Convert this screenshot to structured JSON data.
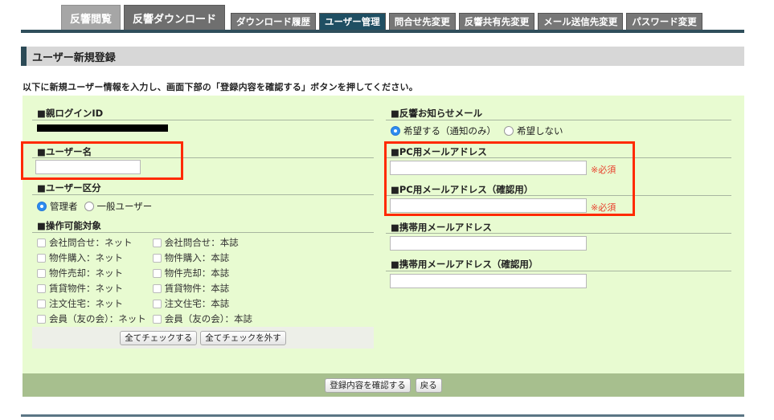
{
  "tabs_main": [
    {
      "label": "反響閲覧",
      "active": false
    },
    {
      "label": "反響ダウンロード",
      "active": true
    }
  ],
  "tabs_sub": [
    {
      "label": "ダウンロード履歴",
      "active": false
    },
    {
      "label": "ユーザー管理",
      "active": true
    },
    {
      "label": "問合せ先変更",
      "active": false
    },
    {
      "label": "反響共有先変更",
      "active": false
    },
    {
      "label": "メール送信先変更",
      "active": false
    },
    {
      "label": "パスワード変更",
      "active": false
    }
  ],
  "section_title": "ユーザー新規登録",
  "instruction": "以下に新規ユーザー情報を入力し、画面下部の「登録内容を確認する」ボタンを押してください。",
  "left": {
    "parent_login_id_label": "■親ログインID",
    "user_name_label": "■ユーザー名",
    "user_type_label": "■ユーザー区分",
    "user_type_options": [
      {
        "label": "管理者",
        "selected": true
      },
      {
        "label": "一般ユーザー",
        "selected": false
      }
    ],
    "operable_label": "■操作可能対象",
    "checkboxes": [
      "会社問合せ：ネット",
      "会社問合せ：本誌",
      "物件購入：ネット",
      "物件購入：本誌",
      "物件売却：ネット",
      "物件売却：本誌",
      "賃貸物件：ネット",
      "賃貸物件：本誌",
      "注文住宅：ネット",
      "注文住宅：本誌",
      "会員（友の会）：ネット",
      "会員（友の会）：本誌"
    ],
    "check_all_button": "全てチェックする",
    "uncheck_all_button": "全てチェックを外す"
  },
  "right": {
    "notify_label": "■反響お知らせメール",
    "notify_options": [
      {
        "label": "希望する（通知のみ）",
        "selected": true
      },
      {
        "label": "希望しない",
        "selected": false
      }
    ],
    "pc_mail_label": "■PC用メールアドレス",
    "pc_mail_confirm_label": "■PC用メールアドレス（確認用）",
    "required_text": "※必須",
    "mobile_mail_label": "■携帯用メールアドレス",
    "mobile_mail_confirm_label": "■携帯用メールアドレス（確認用）"
  },
  "footer": {
    "confirm_button": "登録内容を確認する",
    "back_button": "戻る"
  },
  "colors": {
    "panel_bg": "#e8fbd1",
    "footer_bg": "#a7bf8e",
    "active_tab": "#1f4f63",
    "highlight_box": "#ff2a00",
    "required": "#e83f2b"
  }
}
